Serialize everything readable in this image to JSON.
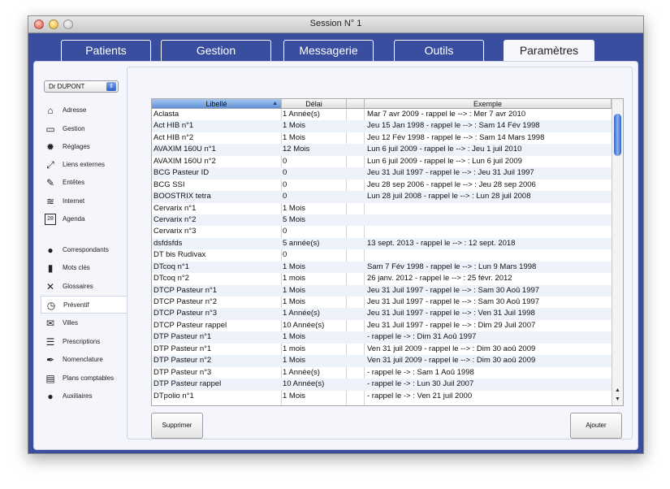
{
  "window": {
    "title": "Session N° 1"
  },
  "tabs": [
    {
      "label": "Patients"
    },
    {
      "label": "Gestion"
    },
    {
      "label": "Messagerie"
    },
    {
      "label": "Outils"
    },
    {
      "label": "Paramètres",
      "active": true
    }
  ],
  "sidebar": {
    "doctor_select": "Dr DUPONT",
    "items": [
      {
        "label": "Adresse",
        "icon": "home-icon",
        "glyph": "⌂"
      },
      {
        "label": "Gestion",
        "icon": "inbox-icon",
        "glyph": "▭"
      },
      {
        "label": "Réglages",
        "icon": "gear-icon",
        "glyph": "✹"
      },
      {
        "label": "Liens externes",
        "icon": "expand-icon",
        "glyph": "⤢"
      },
      {
        "label": "Entêtes",
        "icon": "edit-icon",
        "glyph": "✎"
      },
      {
        "label": "Internet",
        "icon": "wifi-icon",
        "glyph": "≋"
      },
      {
        "label": "Agenda",
        "icon": "calendar-icon",
        "glyph": "28"
      },
      {
        "label": "Correspondants",
        "icon": "person-icon",
        "glyph": "●"
      },
      {
        "label": "Mots clés",
        "icon": "bar-chart-icon",
        "glyph": "▮"
      },
      {
        "label": "Glossaires",
        "icon": "tools-icon",
        "glyph": "✕"
      },
      {
        "label": "Préventif",
        "icon": "clock-icon",
        "glyph": "◷",
        "active": true
      },
      {
        "label": "Villes",
        "icon": "mail-icon",
        "glyph": "✉"
      },
      {
        "label": "Prescriptions",
        "icon": "list-icon",
        "glyph": "☰"
      },
      {
        "label": "Nomenclature",
        "icon": "pen-icon",
        "glyph": "✒"
      },
      {
        "label": "Plans comptables",
        "icon": "grid-icon",
        "glyph": "▤"
      },
      {
        "label": "Auxiliaires",
        "icon": "people-icon",
        "glyph": "●"
      }
    ]
  },
  "table": {
    "columns": [
      "Libellé",
      "Délai",
      "",
      "Exemple"
    ],
    "rows": [
      [
        "Aclasta",
        "1 Année(s)",
        "Mar 7 avr 2009  -  rappel le --> : Mer 7 avr 2010"
      ],
      [
        "Act HIB n°1",
        "1 Mois",
        "Jeu 15 Jan 1998  -  rappel le --> : Sam 14 Fév 1998"
      ],
      [
        "Act HIB n°2",
        "1 Mois",
        "Jeu 12 Fév 1998  -  rappel le --> : Sam 14 Mars 1998"
      ],
      [
        "AVAXIM 160U n°1",
        "12 Mois",
        "Lun 6 juil 2009  -  rappel le --> : Jeu 1 juil 2010"
      ],
      [
        "AVAXIM 160U n°2",
        "0",
        "Lun 6 juil 2009  -  rappel le --> : Lun 6 juil 2009"
      ],
      [
        "BCG Pasteur ID",
        "0",
        "Jeu 31 Juil 1997  -  rappel le --> : Jeu 31 Juil 1997"
      ],
      [
        "BCG SSI",
        "0",
        "Jeu 28 sep 2006  -  rappel le --> : Jeu 28 sep 2006"
      ],
      [
        "BOOSTRIX tetra",
        "0",
        "Lun 28 juil 2008  -  rappel le --> : Lun 28 juil 2008"
      ],
      [
        "Cervarix n°1",
        "1 Mois",
        ""
      ],
      [
        "Cervarix n°2",
        "5 Mois",
        ""
      ],
      [
        "Cervarix n°3",
        "0",
        ""
      ],
      [
        "dsfdsfds",
        "5 année(s)",
        "13 sept. 2013  -  rappel le --> : 12 sept. 2018"
      ],
      [
        "DT bis Rudivax",
        "0",
        ""
      ],
      [
        "DTcoq n°1",
        "1 Mois",
        "Sam 7 Fév 1998  -  rappel le --> : Lun 9 Mars 1998"
      ],
      [
        "DTcoq n°2",
        "1 mois",
        "26 janv. 2012  -  rappel le --> : 25 févr. 2012"
      ],
      [
        "DTCP Pasteur n°1",
        "1 Mois",
        "Jeu 31 Juil 1997  -  rappel le --> : Sam 30 Aoû 1997"
      ],
      [
        "DTCP Pasteur n°2",
        "1 Mois",
        "Jeu 31 Juil 1997  -  rappel le --> : Sam 30 Aoû 1997"
      ],
      [
        "DTCP Pasteur n°3",
        "1 Année(s)",
        "Jeu 31 Juil 1997  -  rappel le --> : Ven 31 Juil 1998"
      ],
      [
        "DTCP Pasteur rappel",
        "10 Année(s)",
        "Jeu 31 Juil 1997  -  rappel le --> : Dim 29 Juil 2007"
      ],
      [
        "DTP Pasteur n°1",
        "1 Mois",
        " -  rappel le -> : Dim 31 Aoû 1997"
      ],
      [
        "DTP Pasteur n°1",
        "1 mois",
        "Ven 31 juil 2009  -  rappel le --> : Dim 30 aoû 2009"
      ],
      [
        "DTP Pasteur n°2",
        "1 Mois",
        "Ven 31 juil 2009  -  rappel le --> : Dim 30 aoû 2009"
      ],
      [
        "DTP Pasteur n°3",
        "1 Année(s)",
        " -  rappel le -> : Sam 1 Aoû 1998"
      ],
      [
        "DTP Pasteur rappel",
        "10 Année(s)",
        " -  rappel le -> : Lun 30 Juil 2007"
      ],
      [
        "DTpolio n°1",
        "1 Mois",
        " -  rappel le -> : Ven 21 juil 2000"
      ]
    ]
  },
  "buttons": {
    "delete": "Supprimer",
    "add": "Ajouter"
  }
}
